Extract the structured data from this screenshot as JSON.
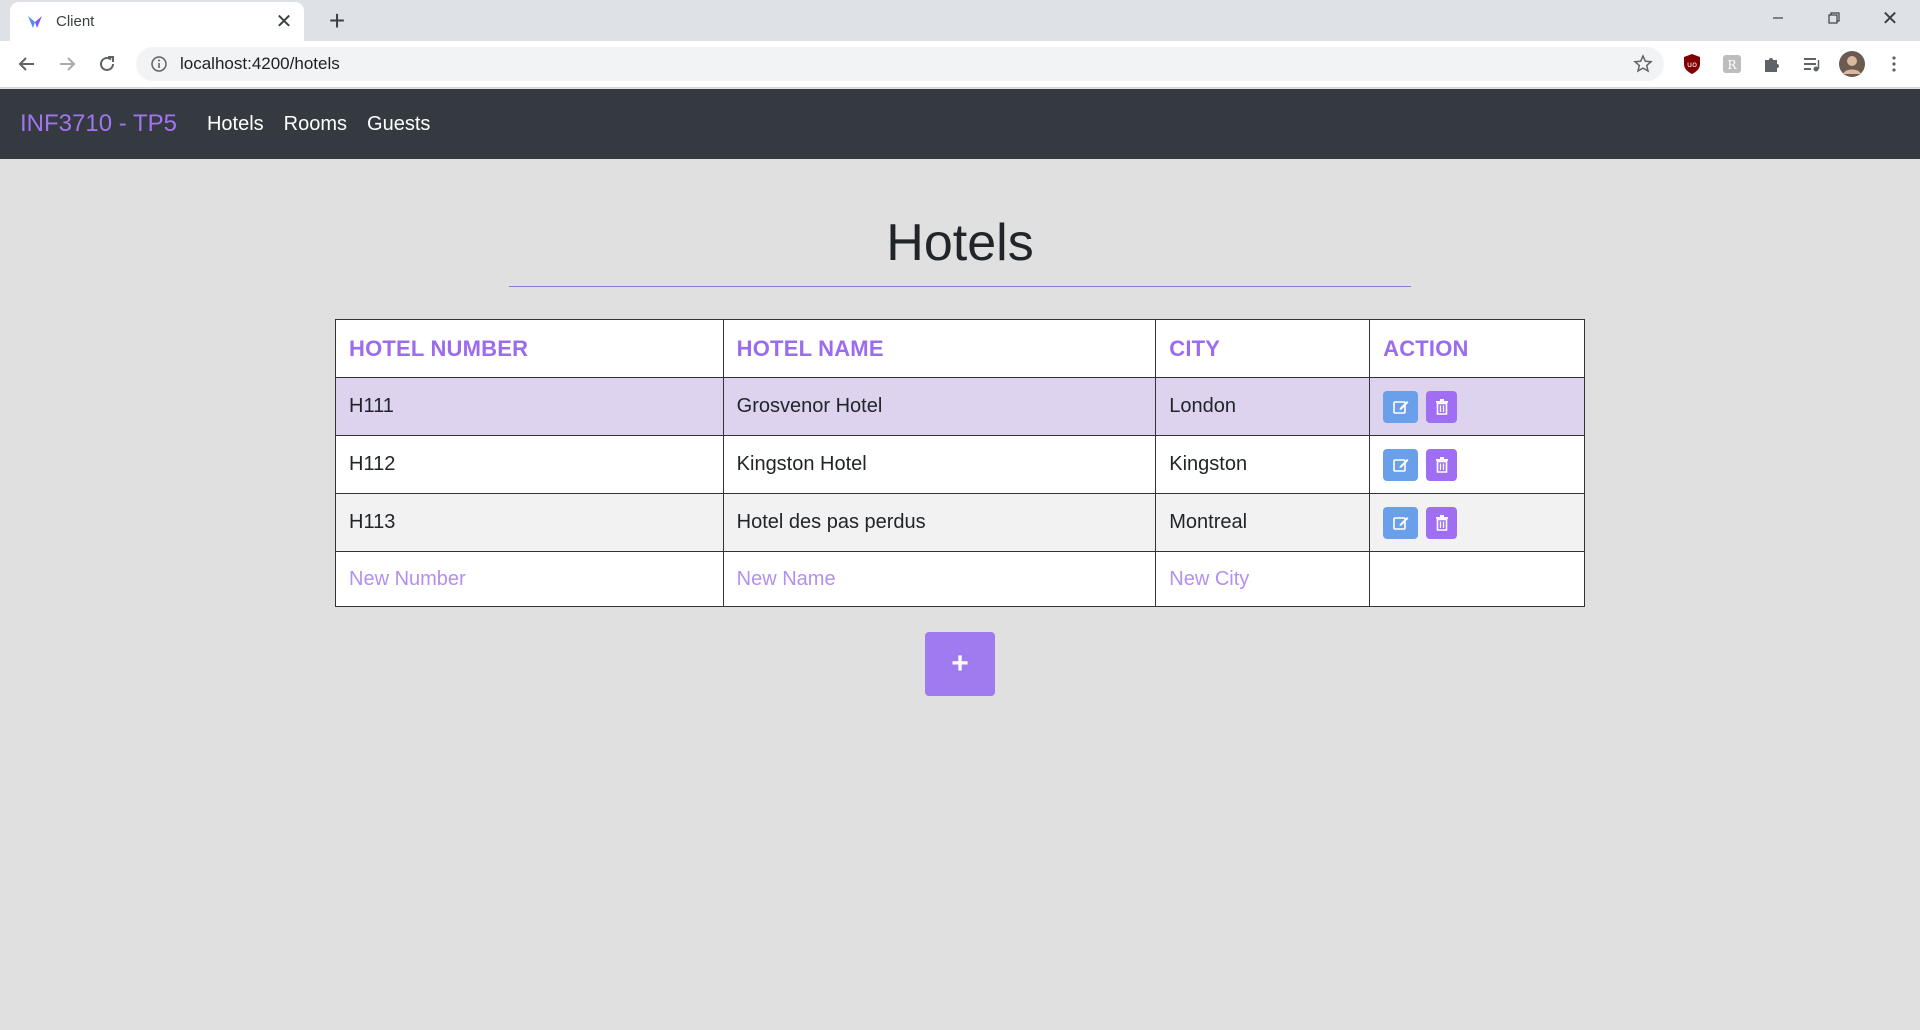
{
  "browser": {
    "tab_title": "Client",
    "url": "localhost:4200/hotels"
  },
  "navbar": {
    "brand": "INF3710 - TP5",
    "links": [
      "Hotels",
      "Rooms",
      "Guests"
    ]
  },
  "page": {
    "title": "Hotels"
  },
  "table": {
    "headers": [
      "HOTEL NUMBER",
      "HOTEL NAME",
      "CITY",
      "ACTION"
    ],
    "rows": [
      {
        "number": "H111",
        "name": "Grosvenor Hotel",
        "city": "London"
      },
      {
        "number": "H112",
        "name": "Kingston Hotel",
        "city": "Kingston"
      },
      {
        "number": "H113",
        "name": "Hotel des pas perdus",
        "city": "Montreal"
      }
    ],
    "new_row": {
      "number_placeholder": "New Number",
      "name_placeholder": "New Name",
      "city_placeholder": "New City"
    }
  },
  "add_button": {
    "label": "+"
  },
  "colors": {
    "accent": "#9b6cee",
    "navbar_bg": "#343a40",
    "edit": "#6aa0ea",
    "delete": "#9f6ef2",
    "highlight_row": "#ddd3ee"
  }
}
